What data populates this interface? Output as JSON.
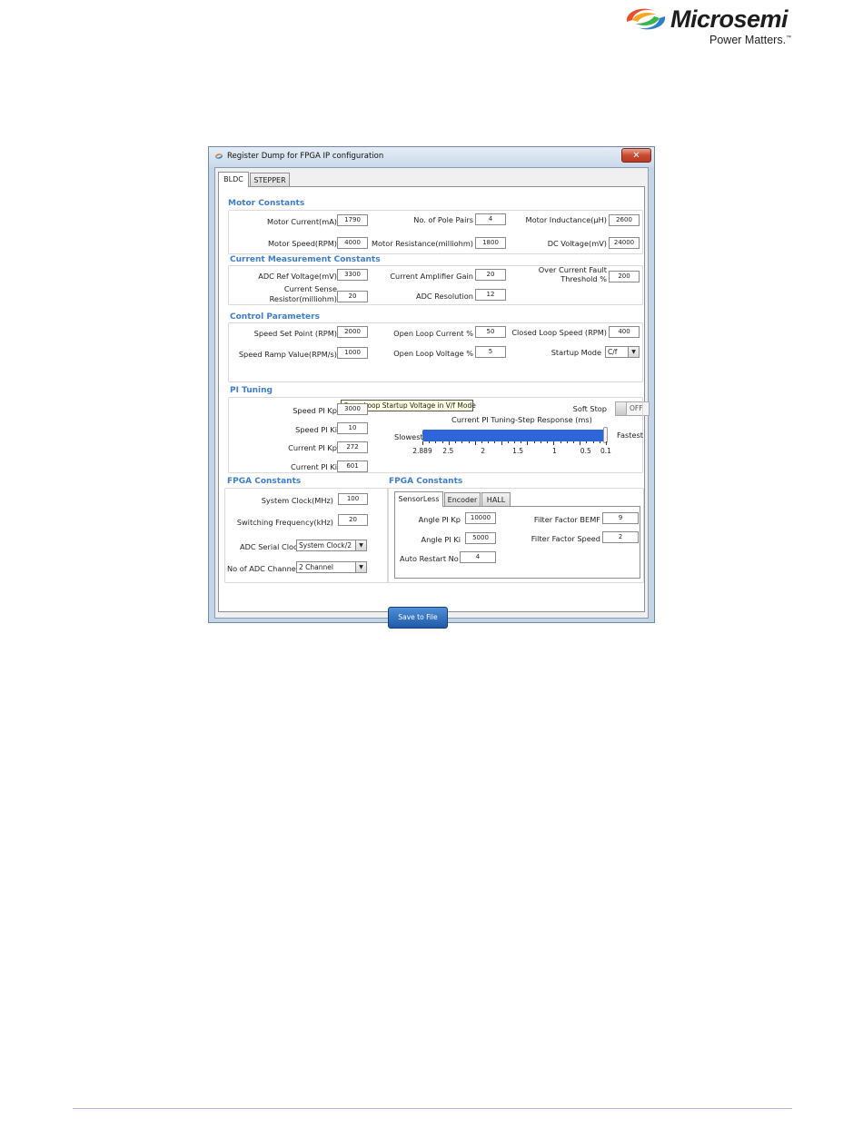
{
  "logo": {
    "wordmark": "Microsemi",
    "tagline": "Power Matters."
  },
  "window": {
    "title": "Register Dump for FPGA IP configuration",
    "close": "✕",
    "tabs": [
      "BLDC",
      "STEPPER"
    ],
    "motor_constants": {
      "title": "Motor Constants",
      "motor_current_label": "Motor Current(mA)",
      "motor_current": "1790",
      "pole_pairs_label": "No. of Pole Pairs",
      "pole_pairs": "4",
      "inductance_label": "Motor Inductance(µH)",
      "inductance": "2600",
      "speed_label": "Motor Speed(RPM)",
      "speed": "4000",
      "resistance_label": "Motor Resistance(milliohm)",
      "resistance": "1800",
      "dc_voltage_label": "DC Voltage(mV)",
      "dc_voltage": "24000"
    },
    "current_measurement": {
      "title": "Current Measurement Constants",
      "adc_ref_label": "ADC Ref Voltage(mV)",
      "adc_ref": "3300",
      "amp_gain_label": "Current Amplifier Gain",
      "amp_gain": "20",
      "overcurrent_label_1": "Over Current Fault",
      "overcurrent_label_2": "Threshold %",
      "overcurrent": "200",
      "sense_resistor_label_1": "Current Sense",
      "sense_resistor_label_2": "Resistor(milliohm)",
      "sense_resistor": "20",
      "adc_resolution_label": "ADC Resolution",
      "adc_resolution": "12"
    },
    "control_parameters": {
      "title": "Control Parameters",
      "speed_set_point_label": "Speed Set Point (RPM)",
      "speed_set_point": "2000",
      "open_loop_current_label": "Open Loop Current %",
      "open_loop_current": "50",
      "closed_loop_speed_label": "Closed Loop Speed (RPM)",
      "closed_loop_speed": "400",
      "speed_ramp_label": "Speed Ramp Value(RPM/s)",
      "speed_ramp": "1000",
      "open_loop_voltage_label": "Open Loop Voltage %",
      "open_loop_voltage": "5",
      "startup_mode_label": "Startup Mode",
      "startup_mode": "C/f",
      "tooltip": "Open Loop Startup Voltage in V/f Mode",
      "soft_stop_label": "Soft Stop",
      "soft_stop_state": "OFF"
    },
    "pi_tuning": {
      "title": "PI Tuning",
      "speed_kp_label": "Speed PI Kp",
      "speed_kp": "3000",
      "speed_ki_label": "Speed PI Ki",
      "speed_ki": "10",
      "current_kp_label": "Current PI Kp",
      "current_kp": "272",
      "current_ki_label": "Current PI Ki",
      "current_ki": "601",
      "slider_title": "Current PI Tuning-Step Response (ms)",
      "slowest": "Slowest",
      "fastest": "Fastest",
      "slider_value_fraction": 1.0,
      "tick_labels": [
        "2.889",
        "2.5",
        "2",
        "1.5",
        "1",
        "0.5",
        "0.1"
      ]
    },
    "fpga_constants_left": {
      "title": "FPGA Constants",
      "system_clock_label": "System Clock(MHz)",
      "system_clock": "100",
      "switching_freq_label": "Switching Frequency(kHz)",
      "switching_freq": "20",
      "adc_serial_clock_label": "ADC Serial Clock",
      "adc_serial_clock": "System Clock/2",
      "adc_channels_label": "No of ADC Channels",
      "adc_channels": "2 Channel"
    },
    "fpga_constants_right": {
      "title": "FPGA Constants",
      "tabs": [
        "SensorLess",
        "Encoder",
        "HALL"
      ],
      "angle_kp_label": "Angle PI Kp",
      "angle_kp": "10000",
      "angle_ki_label": "Angle PI Ki",
      "angle_ki": "5000",
      "auto_restart_label": "Auto Restart No",
      "auto_restart": "4",
      "filter_bemf_label": "Filter Factor BEMF",
      "filter_bemf": "9",
      "filter_speed_label": "Filter Factor Speed",
      "filter_speed": "2"
    },
    "save_button": "Save to File"
  }
}
